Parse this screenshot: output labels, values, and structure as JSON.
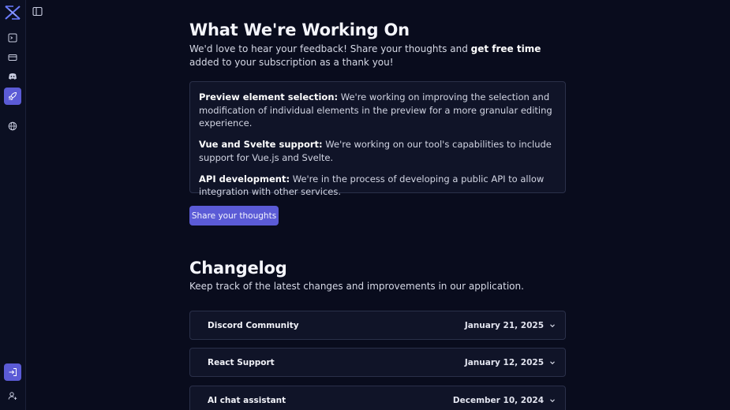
{
  "sidebar": {
    "logo_icon": "app-logo-icon",
    "items": [
      {
        "icon": "terminal-icon"
      },
      {
        "icon": "card-icon"
      },
      {
        "icon": "discord-icon"
      },
      {
        "icon": "rocket-icon",
        "active": true
      },
      {
        "icon": "globe-icon"
      }
    ],
    "bottom": [
      {
        "icon": "sign-in-icon"
      },
      {
        "icon": "user-add-icon"
      }
    ]
  },
  "toolbar": {
    "panel_toggle_icon": "sidebar-toggle-icon"
  },
  "working_on": {
    "title": "What We're Working On",
    "lead_prefix": "We'd love to hear your feedback! Share your thoughts and ",
    "lead_bold": "get free time",
    "lead_suffix": " added to your subscription as a thank you!",
    "features": [
      {
        "name": "Preview element selection:",
        "text": " We're working on improving the selection and modification of individual elements in the preview for a more granular editing experience."
      },
      {
        "name": "Vue and Svelte support:",
        "text": " We're working on our tool's capabilities to include support for Vue.js and Svelte."
      },
      {
        "name": "API development:",
        "text": " We're in the process of developing a public API to allow integration with other services."
      }
    ],
    "cta_label": "Share your thoughts"
  },
  "changelog": {
    "title": "Changelog",
    "subtitle": "Keep track of the latest changes and improvements in our application.",
    "entries": [
      {
        "title": "Discord Community",
        "date": "January 21, 2025"
      },
      {
        "title": "React Support",
        "date": "January 12, 2025"
      },
      {
        "title": "AI chat assistant",
        "date": "December 10, 2024"
      }
    ]
  },
  "colors": {
    "accent": "#5b5bd6",
    "background": "#090c1d",
    "card": "#101428",
    "border": "#2a3049"
  }
}
